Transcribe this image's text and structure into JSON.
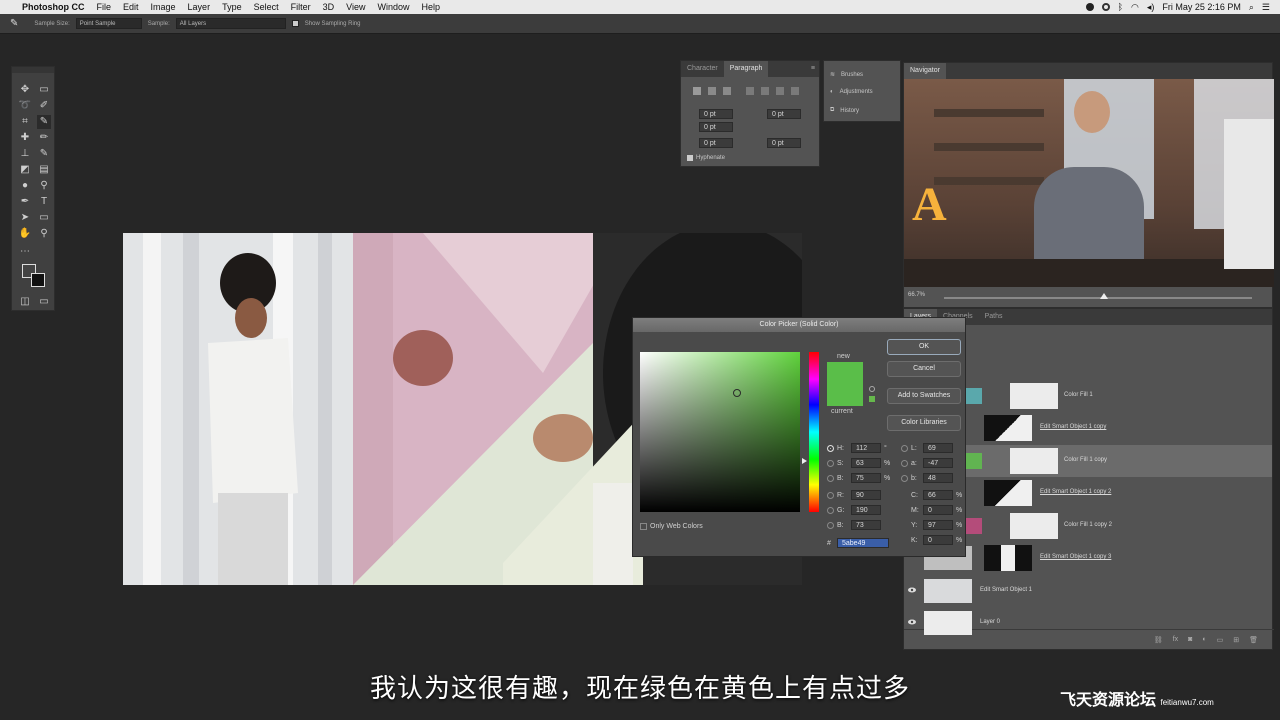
{
  "menubar": {
    "app_name": "Photoshop CC",
    "items": [
      "File",
      "Edit",
      "Image",
      "Layer",
      "Type",
      "Select",
      "Filter",
      "3D",
      "View",
      "Window",
      "Help"
    ],
    "clock": "Fri May 25  2:16 PM"
  },
  "options_bar": {
    "sample_size_label": "Sample Size:",
    "sample_size_value": "Point Sample",
    "sample_label": "Sample:",
    "sample_value": "All Layers",
    "show_ring_label": "Show Sampling Ring"
  },
  "paragraph_panel": {
    "tabs": [
      "Character",
      "Paragraph"
    ],
    "fields": [
      "0 pt",
      "0 pt",
      "0 pt",
      "0 pt",
      "0 pt"
    ],
    "hyphenate_label": "Hyphenate"
  },
  "mini_panels": [
    "Brushes",
    "Adjustments",
    "History"
  ],
  "navigator": {
    "tab": "Navigator",
    "zoom": "66.7%"
  },
  "layers_panel": {
    "tabs": [
      "Layers",
      "Channels",
      "Paths"
    ],
    "layers": [
      {
        "name": "Color Fill 1",
        "thumb": "#5aa8ac",
        "linked": false
      },
      {
        "name": "Edit Smart Object 1 copy",
        "thumb": "bw",
        "linked": true
      },
      {
        "name": "Color Fill 1 copy",
        "thumb": "#61b451",
        "linked": false
      },
      {
        "name": "Edit Smart Object 1 copy 2",
        "thumb": "bw2",
        "linked": true
      },
      {
        "name": "Color Fill 1 copy 2",
        "thumb": "#b44c7a",
        "linked": false
      },
      {
        "name": "Edit Smart Object 1 copy 3",
        "thumb": "bw3",
        "linked": true
      },
      {
        "name": "Edit Smart Object 1",
        "thumb": "photo",
        "linked": false
      },
      {
        "name": "Layer 0",
        "thumb": "#ececec",
        "linked": false
      }
    ]
  },
  "color_picker": {
    "title": "Color Picker (Solid Color)",
    "ok_label": "OK",
    "cancel_label": "Cancel",
    "swatches_label": "Add to Swatches",
    "libraries_label": "Color Libraries",
    "new_label": "new",
    "current_label": "current",
    "only_web_label": "Only Web Colors",
    "hsb": {
      "H": "112",
      "S": "63",
      "B": "75"
    },
    "rgb": {
      "R": "90",
      "G": "190",
      "B": "73"
    },
    "lab": {
      "L": "69",
      "a": "-47",
      "b": "48"
    },
    "cmyk": {
      "C": "66",
      "M": "0",
      "Y": "97",
      "K": "0"
    },
    "hex": "5abe49",
    "new_color": "#5abe49",
    "current_color": "#5abe49"
  },
  "subtitle": "我认为这很有趣，现在绿色在黄色上有点过多",
  "watermark": {
    "main": "飞天资源论坛",
    "url": "feitianwu7.com"
  }
}
